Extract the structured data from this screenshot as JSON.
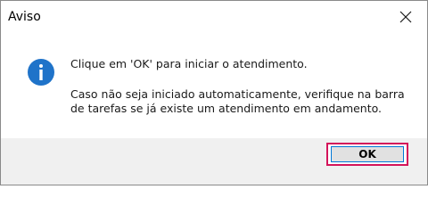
{
  "window": {
    "title": "Aviso"
  },
  "message": {
    "line1": "Clique em 'OK' para iniciar o atendimento.",
    "line2": "Caso não seja iniciado automaticamente, verifique na barra de tarefas se já existe um atendimento em andamento."
  },
  "icons": {
    "info": "info-icon",
    "close": "close-icon"
  },
  "buttons": {
    "ok_label": "OK"
  },
  "colors": {
    "info_blue": "#1f73c9",
    "highlight": "#d4145a",
    "focus_border": "#0078d7",
    "footer_bg": "#f0f0f0"
  }
}
